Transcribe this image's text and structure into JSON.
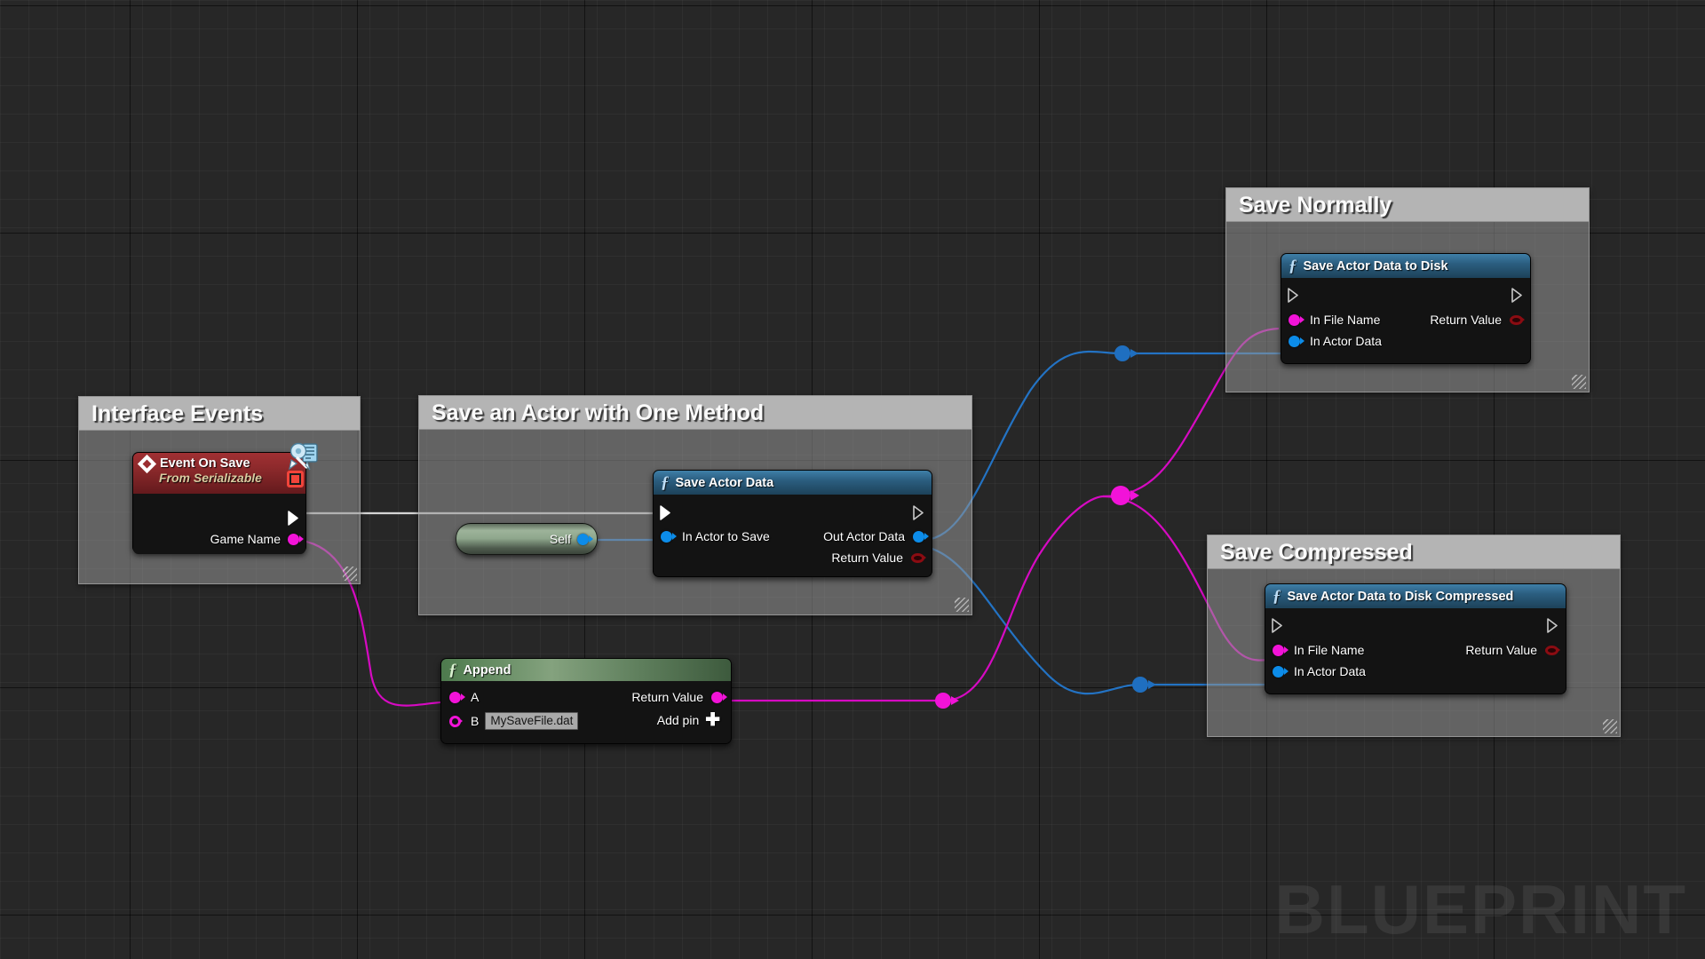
{
  "app": {
    "watermark": "BLUEPRINT"
  },
  "comments": [
    {
      "title": "Interface Events"
    },
    {
      "title": "Save an Actor with One Method"
    },
    {
      "title": "Save Normally"
    },
    {
      "title": "Save Compressed"
    }
  ],
  "nodes": {
    "event_on_save": {
      "title": "Event On Save",
      "subtitle": "From Serializable",
      "output_pins": [
        {
          "label": "",
          "type": "exec"
        },
        {
          "label": "Game Name",
          "type": "string"
        }
      ]
    },
    "self_node": {
      "label": "Self"
    },
    "save_actor_data": {
      "title": "Save Actor Data",
      "input_pins": [
        {
          "label": "",
          "type": "exec"
        },
        {
          "label": "In Actor to Save",
          "type": "object"
        }
      ],
      "output_pins": [
        {
          "label": "",
          "type": "exec"
        },
        {
          "label": "Out Actor Data",
          "type": "object"
        },
        {
          "label": "Return Value",
          "type": "bool"
        }
      ]
    },
    "append": {
      "title": "Append",
      "input_pins": [
        {
          "label": "A",
          "type": "string"
        },
        {
          "label": "B",
          "type": "string",
          "value": "MySaveFile.dat"
        }
      ],
      "output_pins": [
        {
          "label": "Return Value",
          "type": "string"
        }
      ],
      "add_pin_label": "Add pin"
    },
    "save_to_disk": {
      "title": "Save Actor Data to Disk",
      "input_pins": [
        {
          "label": "",
          "type": "exec"
        },
        {
          "label": "In File Name",
          "type": "string"
        },
        {
          "label": "In Actor Data",
          "type": "object"
        }
      ],
      "output_pins": [
        {
          "label": "",
          "type": "exec"
        },
        {
          "label": "Return Value",
          "type": "bool"
        }
      ]
    },
    "save_to_disk_compressed": {
      "title": "Save Actor Data to Disk Compressed",
      "input_pins": [
        {
          "label": "",
          "type": "exec"
        },
        {
          "label": "In File Name",
          "type": "string"
        },
        {
          "label": "In Actor Data",
          "type": "object"
        }
      ],
      "output_pins": [
        {
          "label": "",
          "type": "exec"
        },
        {
          "label": "Return Value",
          "type": "bool"
        }
      ]
    }
  },
  "colors": {
    "exec_wire": "#d4d4d4",
    "string_wire": "#d60ac2",
    "object_wire": "#2373c4",
    "pin_magenta": "#f213d8",
    "pin_blue": "#0c8ce9",
    "pin_bool": "#8b0c12",
    "comment_bar": "#b4b4b4",
    "canvas_bg": "#272727"
  }
}
